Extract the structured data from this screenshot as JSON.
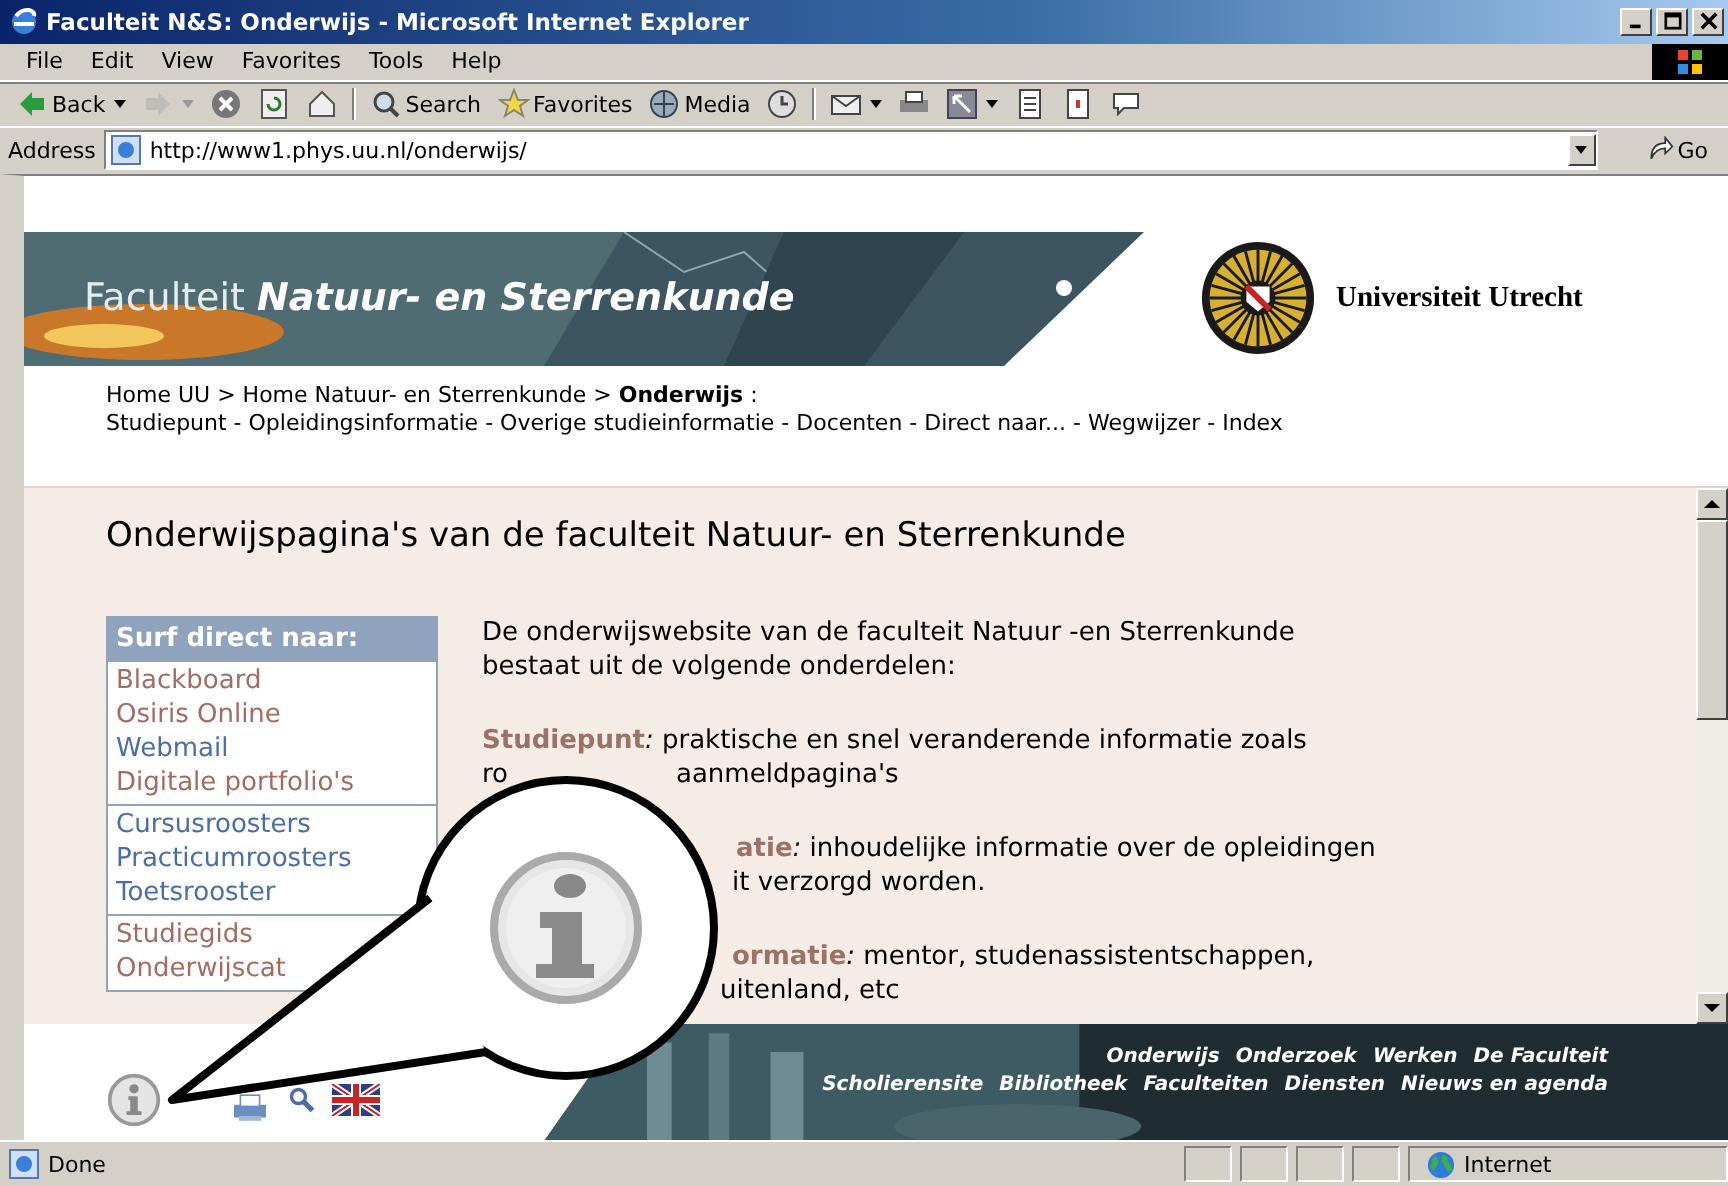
{
  "window": {
    "title": "Faculteit N&S: Onderwijs - Microsoft Internet Explorer"
  },
  "menu": [
    "File",
    "Edit",
    "View",
    "Favorites",
    "Tools",
    "Help"
  ],
  "toolbar": [
    {
      "kind": "back",
      "label": "Back",
      "dropdown": true,
      "disabled": false
    },
    {
      "kind": "forward",
      "dropdown": true,
      "disabled": true
    },
    {
      "kind": "stop",
      "disabled": false
    },
    {
      "kind": "refresh",
      "disabled": false
    },
    {
      "kind": "home",
      "disabled": false
    },
    {
      "kind": "search",
      "label": "Search",
      "disabled": false
    },
    {
      "kind": "favorites",
      "label": "Favorites",
      "disabled": false
    },
    {
      "kind": "media",
      "label": "Media",
      "disabled": false
    },
    {
      "kind": "history",
      "disabled": false
    },
    {
      "kind": "mail",
      "dropdown": true,
      "disabled": false
    },
    {
      "kind": "print",
      "disabled": false
    },
    {
      "kind": "edit",
      "dropdown": true,
      "disabled": false
    },
    {
      "kind": "document",
      "disabled": false
    },
    {
      "kind": "page",
      "disabled": false
    },
    {
      "kind": "messenger",
      "disabled": false
    }
  ],
  "address": {
    "label": "Address",
    "value": "http://www1.phys.uu.nl/onderwijs/",
    "go": "Go"
  },
  "banner": {
    "prefix": "Faculteit",
    "name": "Natuur- en Sterrenkunde",
    "university": "Universiteit Utrecht"
  },
  "breadcrumb": [
    "Home UU > Home Natuur- en Sterrenkunde > **Onderwijs** :",
    "Studiepunt - Opleidingsinformatie - Overige studieinformatie - Docenten - Direct naar... - Wegwijzer - Index"
  ],
  "heading": "Onderwijspagina's van de faculteit Natuur- en Sterrenkunde",
  "sidebar": {
    "title": "Surf direct naar:",
    "groups": [
      [
        {
          "label": "Blackboard",
          "visited": true
        },
        {
          "label": "Osiris Online",
          "visited": true
        },
        {
          "label": "Webmail",
          "visited": false
        },
        {
          "label": "Digitale portfolio's",
          "visited": true
        }
      ],
      [
        {
          "label": "Cursusroosters",
          "visited": false
        },
        {
          "label": "Practicumroosters",
          "visited": false
        },
        {
          "label": "Toetsrooster",
          "visited": false
        }
      ],
      [
        {
          "label": "Studiegids",
          "visited": true
        },
        {
          "label": "Onderwijscat",
          "visited": true
        }
      ]
    ]
  },
  "sections": [
    [
      [
        {
          "text": "De onderwijswebsite van de faculteit Natuur -en Sterrenkunde"
        }
      ],
      [
        {
          "text": "bestaat uit de volgende onderdelen:"
        }
      ]
    ],
    [
      [
        {
          "term": "Studiepunt",
          "text": "*:* praktische en snel veranderende informatie zoals"
        }
      ],
      [
        {
          "text": "ro"
        },
        {
          "text": "aanmeldpagina's"
        }
      ]
    ],
    [
      [
        {
          "term": "atie",
          "text": "*:* inhoudelijke informatie over de opleidingen"
        }
      ],
      [
        {
          "text": "it verzorgd worden."
        }
      ]
    ],
    [
      [
        {
          "term": "ormatie",
          "text": "*:* mentor, studenassistentschappen,"
        }
      ],
      [
        {
          "text": "uitenland, etc"
        }
      ]
    ]
  ],
  "footer": {
    "links_top": [
      "Onderwijs",
      "Onderzoek",
      "Werken",
      "De Faculteit"
    ],
    "links_bottom": [
      "Scholierensite",
      "Bibliotheek",
      "Faculteiten",
      "Diensten",
      "Nieuws en agenda"
    ]
  },
  "status": {
    "text": "Done",
    "zone": "Internet"
  }
}
